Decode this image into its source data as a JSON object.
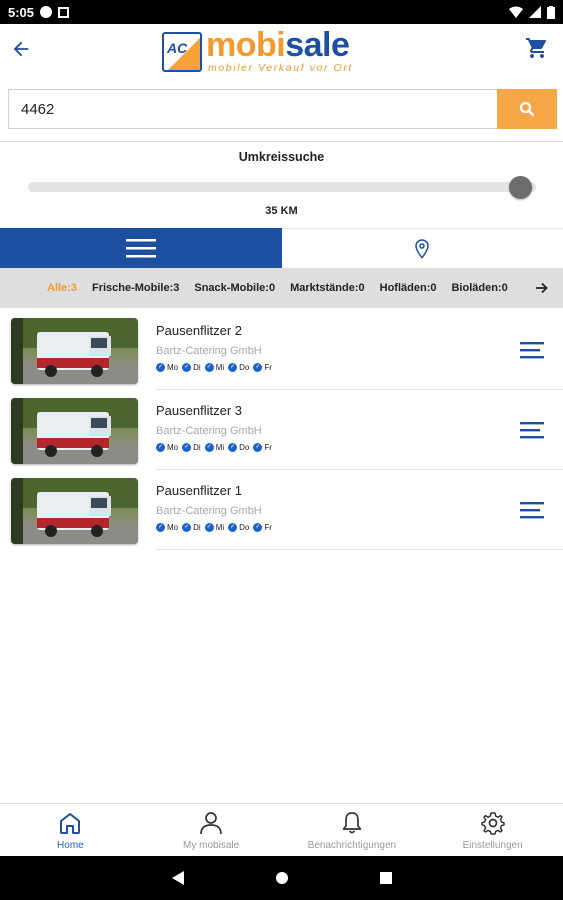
{
  "status_bar": {
    "time": "5:05"
  },
  "app": {
    "logo_word_1": "mobi",
    "logo_word_2": "sale",
    "logo_tagline": "mobiler Verkauf vor Ort",
    "brand_orange": "#f29a2e",
    "brand_blue": "#1d4fa1"
  },
  "search": {
    "value": "4462"
  },
  "radius": {
    "title": "Umkreissuche",
    "value_label": "35 KM",
    "level": 0.97
  },
  "view_toggle": {
    "active": "list",
    "icons": [
      "menu-icon",
      "location-pin-icon"
    ]
  },
  "categories": [
    {
      "label": "Alle:3",
      "active": true
    },
    {
      "label": "Frische-Mobile:3",
      "active": false
    },
    {
      "label": "Snack-Mobile:0",
      "active": false
    },
    {
      "label": "Marktstände:0",
      "active": false
    },
    {
      "label": "Hofläden:0",
      "active": false
    },
    {
      "label": "Bioläden:0",
      "active": false
    }
  ],
  "vendors": [
    {
      "name": "Pausenflitzer 2",
      "company": "Bartz-Catering GmbH",
      "days": [
        "Mo",
        "Di",
        "Mi",
        "Do",
        "Fr"
      ]
    },
    {
      "name": "Pausenflitzer 3",
      "company": "Bartz-Catering GmbH",
      "days": [
        "Mo",
        "Di",
        "Mi",
        "Do",
        "Fr"
      ]
    },
    {
      "name": "Pausenflitzer 1",
      "company": "Bartz-Catering GmbH",
      "days": [
        "Mo",
        "Di",
        "Mi",
        "Do",
        "Fr"
      ]
    }
  ],
  "bottom_nav": [
    {
      "label": "Home",
      "icon": "home-icon",
      "active": true
    },
    {
      "label": "My mobisale",
      "icon": "person-icon",
      "active": false
    },
    {
      "label": "Benachrichtigungen",
      "icon": "bell-icon",
      "active": false
    },
    {
      "label": "Einstellungen",
      "icon": "gear-icon",
      "active": false
    }
  ]
}
